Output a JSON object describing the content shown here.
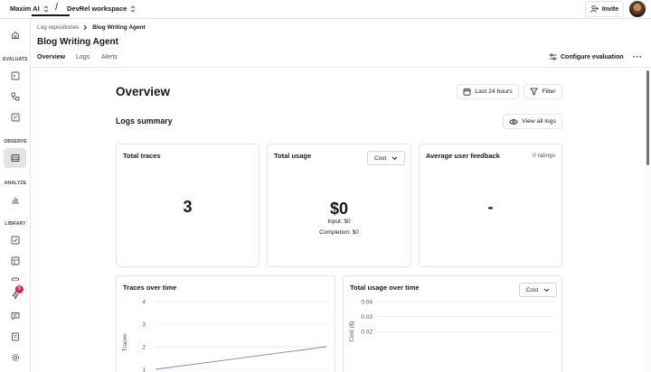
{
  "topbar": {
    "org": "Maxim AI",
    "separator": "/",
    "workspace": "DevRel workspace",
    "invite_label": "Invite"
  },
  "sidebar": {
    "sections": [
      "EVALUATE",
      "OBSERVE",
      "ANALYZE",
      "LIBRARY"
    ],
    "notification_badge": "5"
  },
  "breadcrumb": [
    "Log repositories",
    "Blog Writing Agent"
  ],
  "page_title": "Blog Writing Agent",
  "tabs": [
    "Overview",
    "Logs",
    "Alerts"
  ],
  "active_tab": "Overview",
  "configure_label": "Configure evaluation",
  "more_label": "···",
  "overview": {
    "title": "Overview",
    "range_label": "Last 24 hours",
    "filter_label": "Filter",
    "logs_summary_title": "Logs summary",
    "view_all_label": "View all logs"
  },
  "cards": {
    "total_traces": {
      "title": "Total traces",
      "value": "3"
    },
    "total_usage": {
      "title": "Total usage",
      "dropdown": "Cost",
      "value": "$0",
      "input": "Input: $0",
      "completion": "Completion: $0"
    },
    "feedback": {
      "title": "Average user feedback",
      "ratings": "0 ratings",
      "value": "-"
    }
  },
  "charts_text": {
    "traces_title": "Traces over time",
    "usage_title": "Total usage over time",
    "usage_dropdown": "Cost"
  },
  "colors": {
    "accent": "#18181b",
    "line": "#8b7fc7",
    "badge": "#e11d48",
    "border": "#e4e4e7"
  },
  "chart_data": [
    {
      "type": "line",
      "title": "Traces over time",
      "ylabel": "Traces",
      "yticks": [
        "4",
        "3",
        "2",
        "1"
      ],
      "ylim": [
        1,
        4
      ],
      "series": [
        {
          "values": [
            1,
            2
          ]
        }
      ],
      "grid": true
    },
    {
      "type": "line",
      "title": "Total usage over time",
      "ylabel": "Cost ($)",
      "yticks": [
        "0.04",
        "0.03",
        "0.02"
      ],
      "ylim": [
        0.01,
        0.04
      ],
      "series": [],
      "grid": true
    }
  ]
}
